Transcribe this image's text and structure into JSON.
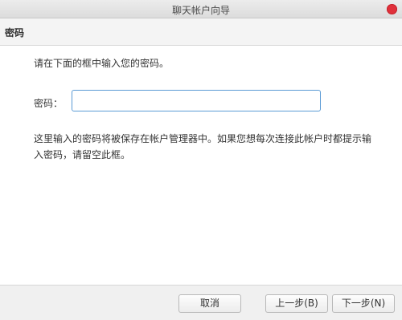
{
  "window": {
    "title": "聊天帐户向导"
  },
  "header": {
    "title": "密码"
  },
  "main": {
    "instruction": "请在下面的框中输入您的密码。",
    "password_label": "密码：",
    "password_value": "",
    "description": "这里输入的密码将被保存在帐户管理器中。如果您想每次连接此帐户时都提示输入密码，请留空此框。"
  },
  "footer": {
    "cancel_label": "取消",
    "back_label": "上一步(B)",
    "next_label": "下一步(N)"
  },
  "colors": {
    "close_button": "#e0303a",
    "input_focus_border": "#5b9bd5"
  }
}
